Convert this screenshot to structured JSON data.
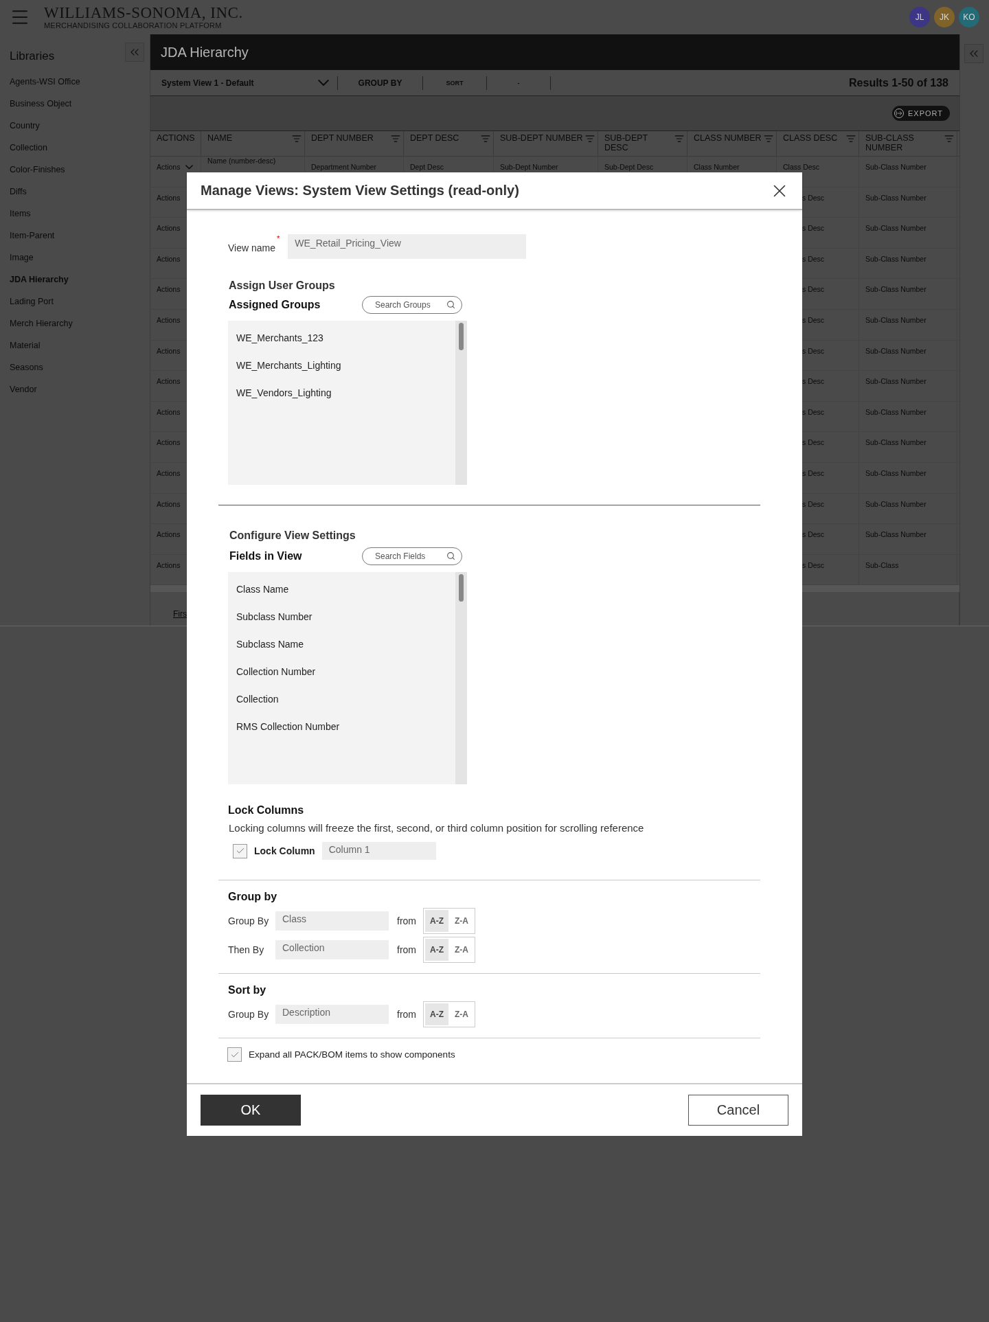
{
  "header": {
    "logo_title": "WILLIAMS-SONOMA, INC.",
    "logo_subtitle": "MERCHANDISING COLLABORATION PLATFORM",
    "avatars": [
      {
        "initials": "JL",
        "color": "#3d3585"
      },
      {
        "initials": "JK",
        "color": "#806328"
      },
      {
        "initials": "KO",
        "color": "#246b78"
      }
    ]
  },
  "sidebar": {
    "title": "Libraries",
    "items": [
      {
        "label": "Agents-WSI Office",
        "selected": false
      },
      {
        "label": "Business Object",
        "selected": false
      },
      {
        "label": "Country",
        "selected": false
      },
      {
        "label": "Collection",
        "selected": false
      },
      {
        "label": "Color-Finishes",
        "selected": false
      },
      {
        "label": "Diffs",
        "selected": false
      },
      {
        "label": "Items",
        "selected": false
      },
      {
        "label": "Item-Parent",
        "selected": false
      },
      {
        "label": "Image",
        "selected": false
      },
      {
        "label": "JDA Hierarchy",
        "selected": true
      },
      {
        "label": "Lading Port",
        "selected": false
      },
      {
        "label": "Merch Hierarchy",
        "selected": false
      },
      {
        "label": "Material",
        "selected": false
      },
      {
        "label": "Seasons",
        "selected": false
      },
      {
        "label": "Vendor",
        "selected": false
      }
    ]
  },
  "page": {
    "title": "JDA Hierarchy",
    "view_select": "System View 1 - Default",
    "group_by": "GROUP BY",
    "sort": "SORT",
    "extra": "-",
    "results": "Results 1-50 of 138",
    "export": "EXPORT"
  },
  "table": {
    "columns": [
      "ACTIONS",
      "NAME",
      "DEPT NUMBER",
      "DEPT DESC",
      "SUB-DEPT NUMBER",
      "SUB-DEPT DESC",
      "CLASS NUMBER",
      "CLASS DESC",
      "SUB-CLASS NUMBER"
    ],
    "rows": [
      {
        "cells": [
          "Actions",
          "Name (number-desc)",
          "Department Number",
          "Dept Desc",
          "Sub-Dept Number",
          "Sub-Dept Desc",
          "Class Number",
          "Class Desc",
          "Sub-Class Number"
        ],
        "dropdown": true
      },
      {
        "cells": [
          "Actions",
          null,
          null,
          null,
          null,
          null,
          null,
          "s Desc",
          "Sub-Class Number"
        ],
        "dropdown": false
      },
      {
        "cells": [
          "Actions",
          null,
          null,
          null,
          null,
          null,
          null,
          "s Desc",
          "Sub-Class Number"
        ],
        "dropdown": false
      },
      {
        "cells": [
          "Actions",
          null,
          null,
          null,
          null,
          null,
          null,
          "s Desc",
          "Sub-Class Number"
        ],
        "dropdown": false
      },
      {
        "cells": [
          "Actions",
          null,
          null,
          null,
          null,
          null,
          null,
          "s Desc",
          "Sub-Class Number"
        ],
        "dropdown": false
      },
      {
        "cells": [
          "Actions",
          null,
          null,
          null,
          null,
          null,
          null,
          "s Desc",
          "Sub-Class Number"
        ],
        "dropdown": false
      },
      {
        "cells": [
          "Actions",
          null,
          null,
          null,
          null,
          null,
          null,
          "s Desc",
          "Sub-Class Number"
        ],
        "dropdown": false
      },
      {
        "cells": [
          "Actions",
          null,
          null,
          null,
          null,
          null,
          null,
          "s Desc",
          "Sub-Class Number"
        ],
        "dropdown": false
      },
      {
        "cells": [
          "Actions",
          null,
          null,
          null,
          null,
          null,
          null,
          "s Desc",
          "Sub-Class Number"
        ],
        "dropdown": false
      },
      {
        "cells": [
          "Actions",
          null,
          null,
          null,
          null,
          null,
          null,
          "s Desc",
          "Sub-Class Number"
        ],
        "dropdown": false
      },
      {
        "cells": [
          "Actions",
          null,
          null,
          null,
          null,
          null,
          null,
          "s Desc",
          "Sub-Class Number"
        ],
        "dropdown": false
      },
      {
        "cells": [
          "Actions",
          null,
          null,
          null,
          null,
          null,
          null,
          "s Desc",
          "Sub-Class Number"
        ],
        "dropdown": false
      },
      {
        "cells": [
          "Actions",
          null,
          null,
          null,
          null,
          null,
          null,
          "s Desc",
          "Sub-Class Number"
        ],
        "dropdown": false
      },
      {
        "cells": [
          "Actions",
          null,
          null,
          null,
          null,
          null,
          null,
          "s Desc",
          "Sub-Class"
        ],
        "dropdown": false
      }
    ],
    "pager_link": "Firs"
  },
  "modal": {
    "title": "Manage Views: System View Settings (read-only)",
    "view_name": {
      "label": "View name",
      "required_mark": "*",
      "value": "WE_Retail_Pricing_View"
    },
    "groups": {
      "section_title": "Assign User Groups",
      "list_title": "Assigned Groups",
      "search_placeholder": "Search Groups",
      "items": [
        "WE_Merchants_123",
        "WE_Merchants_Lighting",
        "WE_Vendors_Lighting"
      ]
    },
    "fields": {
      "section_title": "Configure View Settings",
      "list_title": "Fields in View",
      "search_placeholder": "Search Fields",
      "items": [
        "Class Name",
        "Subclass Number",
        "Subclass Name",
        "Collection Number",
        "Collection",
        "RMS Collection Number"
      ]
    },
    "lock": {
      "title": "Lock Columns",
      "description": "Locking columns will freeze the first, second, or third column position for scrolling reference",
      "checkbox_label": "Lock Column",
      "checked": true,
      "value": "Column 1"
    },
    "group_by": {
      "title": "Group by",
      "rows": [
        {
          "label": "Group By",
          "value": "Class",
          "from": "from",
          "orders": [
            {
              "label": "A-Z",
              "selected": true
            },
            {
              "label": "Z-A",
              "selected": false
            }
          ]
        },
        {
          "label": "Then By",
          "value": "Collection",
          "from": "from",
          "orders": [
            {
              "label": "A-Z",
              "selected": true
            },
            {
              "label": "Z-A",
              "selected": false
            }
          ]
        }
      ]
    },
    "sort_by": {
      "title": "Sort by",
      "rows": [
        {
          "label": "Group By",
          "value": "Description",
          "from": "from",
          "orders": [
            {
              "label": "A-Z",
              "selected": true
            },
            {
              "label": "Z-A",
              "selected": false
            }
          ]
        }
      ]
    },
    "expand": {
      "label": "Expand all PACK/BOM items to show components",
      "checked": true
    },
    "ok": "OK",
    "cancel": "Cancel"
  }
}
